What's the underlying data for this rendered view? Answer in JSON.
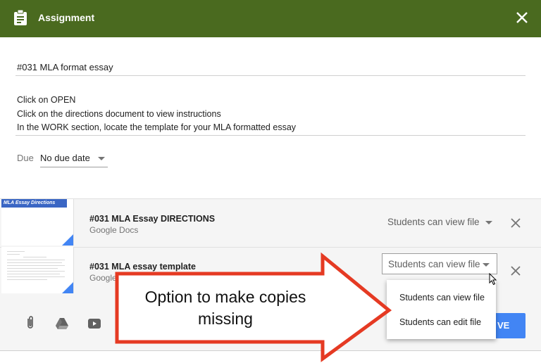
{
  "header": {
    "title": "Assignment",
    "icon": "clipboard-icon",
    "close_icon": "close-icon",
    "background": "#4a6a1f"
  },
  "form": {
    "title_value": "#031 MLA format essay",
    "instructions": [
      "Click on OPEN",
      "Click on the directions document to view instructions",
      "In the WORK section, locate the template for your MLA formatted essay"
    ],
    "due_label": "Due",
    "due_value": "No due date"
  },
  "attachments": [
    {
      "name": "#031 MLA Essay DIRECTIONS",
      "type": "Google Docs",
      "thumb_label": "MLA Essay Directions",
      "permission": "Students can view file"
    },
    {
      "name": "#031 MLA essay template",
      "type": "Google Docs",
      "permission": "Students can view file"
    }
  ],
  "dropdown": {
    "options": [
      "Students can view file",
      "Students can edit file"
    ]
  },
  "toolbar": {
    "icons": [
      "paperclip-icon",
      "google-drive-icon",
      "youtube-icon"
    ],
    "assign_label": "VE",
    "accent": "#4285f4"
  },
  "annotation": {
    "text_line1": "Option to make copies",
    "text_line2": "missing",
    "arrow_color": "#e53a23"
  }
}
